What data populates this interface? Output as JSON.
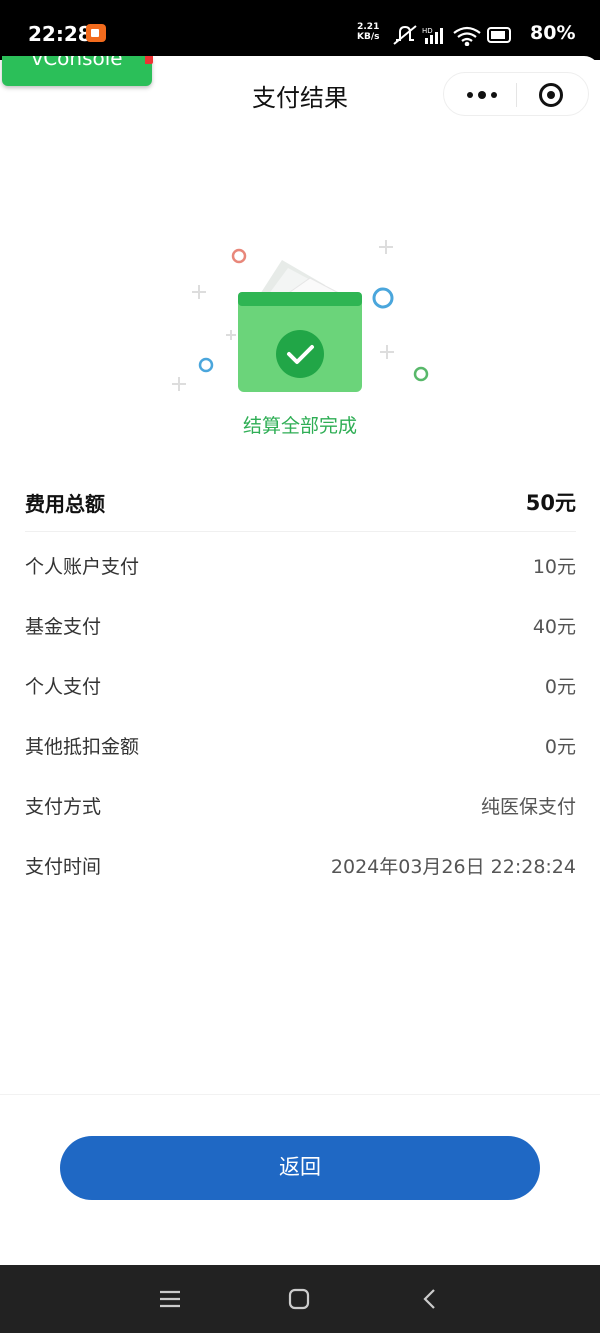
{
  "status_bar": {
    "time": "22:28",
    "net_speed_value": "2.21",
    "net_speed_unit": "KB/s",
    "battery": "80%"
  },
  "vconsole_label": "vConsole",
  "nav": {
    "title": "支付结果"
  },
  "result": {
    "status_text": "结算全部完成"
  },
  "details": {
    "total": {
      "label": "费用总额",
      "value": "50元"
    },
    "rows": [
      {
        "label": "个人账户支付",
        "value": "10元"
      },
      {
        "label": "基金支付",
        "value": "40元"
      },
      {
        "label": "个人支付",
        "value": "0元"
      },
      {
        "label": "其他抵扣金额",
        "value": "0元"
      },
      {
        "label": "支付方式",
        "value": "纯医保支付"
      },
      {
        "label": "支付时间",
        "value": "2024年03月26日 22:28:24"
      }
    ]
  },
  "actions": {
    "return_label": "返回"
  },
  "colors": {
    "accent_green": "#2fae55",
    "button_blue": "#1f68c4"
  }
}
